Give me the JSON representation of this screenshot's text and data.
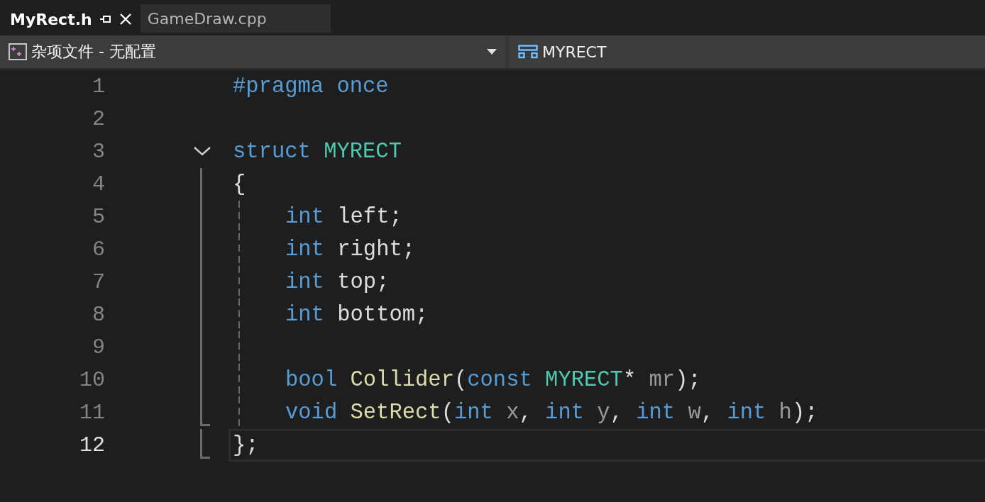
{
  "tabs": [
    {
      "label": "MyRect.h",
      "selected": true
    },
    {
      "label": "GameDraw.cpp",
      "selected": false
    }
  ],
  "navigation_bar": {
    "project": "杂项文件 - 无配置",
    "scope": "MYRECT"
  },
  "editor": {
    "lines": [
      {
        "number": "1",
        "tokens": [
          {
            "text": "#pragma once",
            "kind": "keyword"
          }
        ]
      },
      {
        "number": "2"
      },
      {
        "number": "3",
        "foldable": true,
        "expanded": true,
        "tokens": [
          {
            "text": "struct",
            "kind": "keyword",
            "space_after": true
          },
          {
            "text": "MYRECT",
            "kind": "type"
          }
        ],
        "children": [
          {
            "number": "4",
            "tokens": [
              {
                "text": "{",
                "kind": "plain"
              }
            ],
            "children": [
              {
                "number": "5",
                "tokens": [
                  {
                    "text": "int",
                    "kind": "keyword",
                    "space_after": true
                  },
                  {
                    "text": "left;",
                    "kind": "plain"
                  }
                ]
              },
              {
                "number": "6",
                "tokens": [
                  {
                    "text": "int",
                    "kind": "keyword",
                    "space_after": true
                  },
                  {
                    "text": "right;",
                    "kind": "plain"
                  }
                ]
              },
              {
                "number": "7",
                "tokens": [
                  {
                    "text": "int",
                    "kind": "keyword",
                    "space_after": true
                  },
                  {
                    "text": "top;",
                    "kind": "plain"
                  }
                ]
              },
              {
                "number": "8",
                "tokens": [
                  {
                    "text": "int",
                    "kind": "keyword",
                    "space_after": true
                  },
                  {
                    "text": "bottom;",
                    "kind": "plain"
                  }
                ]
              },
              {
                "number": "9"
              },
              {
                "number": "10",
                "tokens": [
                  {
                    "text": "bool",
                    "kind": "keyword",
                    "space_after": true
                  },
                  {
                    "text": "Collider",
                    "kind": "function"
                  },
                  {
                    "text": "(",
                    "kind": "plain"
                  },
                  {
                    "text": "const",
                    "kind": "keyword",
                    "space_after": true
                  },
                  {
                    "text": "MYRECT",
                    "kind": "type"
                  },
                  {
                    "text": "*",
                    "kind": "plain",
                    "space_after": true
                  },
                  {
                    "text": "mr",
                    "kind": "param"
                  },
                  {
                    "text": ");",
                    "kind": "plain"
                  }
                ]
              },
              {
                "number": "11",
                "tokens": [
                  {
                    "text": "void",
                    "kind": "keyword",
                    "space_after": true
                  },
                  {
                    "text": "SetRect",
                    "kind": "function"
                  },
                  {
                    "text": "(",
                    "kind": "plain"
                  },
                  {
                    "text": "int",
                    "kind": "keyword",
                    "space_after": true
                  },
                  {
                    "text": "x",
                    "kind": "param"
                  },
                  {
                    "text": ",",
                    "kind": "plain",
                    "space_after": true
                  },
                  {
                    "text": "int",
                    "kind": "keyword",
                    "space_after": true
                  },
                  {
                    "text": "y",
                    "kind": "param"
                  },
                  {
                    "text": ",",
                    "kind": "plain",
                    "space_after": true
                  },
                  {
                    "text": "int",
                    "kind": "keyword",
                    "space_after": true
                  },
                  {
                    "text": "w",
                    "kind": "param"
                  },
                  {
                    "text": ",",
                    "kind": "plain",
                    "space_after": true
                  },
                  {
                    "text": "int",
                    "kind": "keyword",
                    "space_after": true
                  },
                  {
                    "text": "h",
                    "kind": "param"
                  },
                  {
                    "text": ");",
                    "kind": "plain"
                  }
                ]
              }
            ]
          },
          {
            "number": "12",
            "current": true,
            "tokens": [
              {
                "text": "};",
                "kind": "plain"
              }
            ]
          }
        ]
      }
    ]
  }
}
